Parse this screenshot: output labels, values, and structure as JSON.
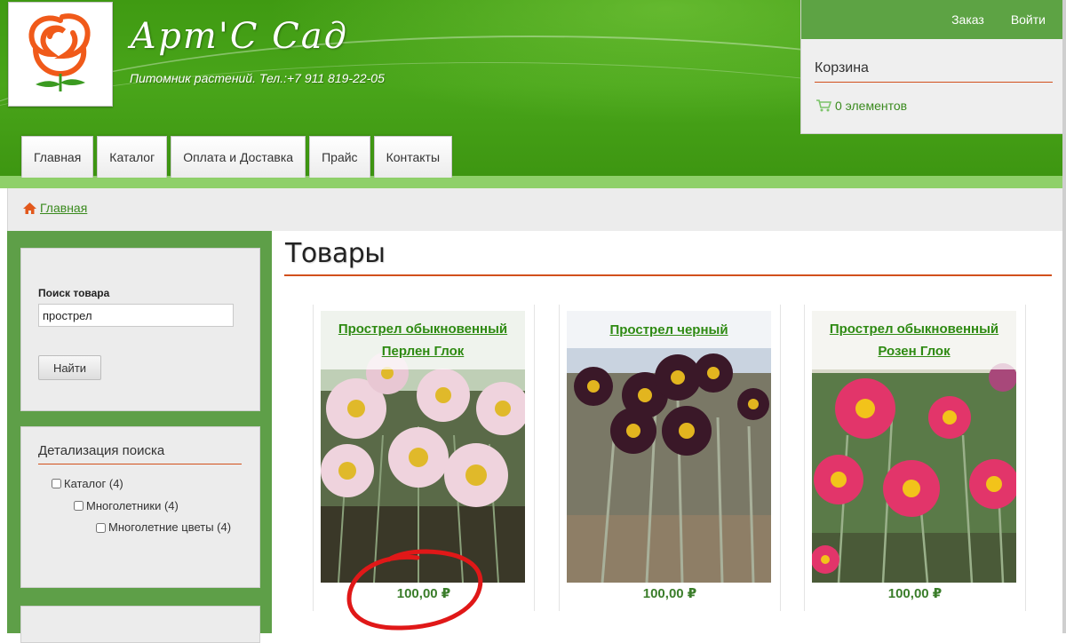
{
  "site": {
    "title": "Арт'С Сад",
    "subtitle": "Питомник растений. Тел.:+7 911 819-22-05"
  },
  "nav": {
    "items": [
      "Главная",
      "Каталог",
      "Оплата и Доставка",
      "Прайс",
      "Контакты"
    ]
  },
  "user_links": {
    "order": "Заказ",
    "login": "Войти"
  },
  "cart": {
    "title": "Корзина",
    "count_text": "0 элементов"
  },
  "breadcrumb": {
    "home": "Главная"
  },
  "search": {
    "label": "Поиск товара",
    "value": "прострел",
    "button": "Найти"
  },
  "refine": {
    "title": "Детализация поиска",
    "items": [
      {
        "label": "Каталог (4)",
        "checked": false
      },
      {
        "label": "Многолетники (4)",
        "checked": false
      },
      {
        "label": "Многолетние цветы (4)",
        "checked": false
      }
    ]
  },
  "main": {
    "title": "Товары"
  },
  "products": [
    {
      "name": "Прострел обыкновенный Перлен Глок",
      "price": "100,00 ₽",
      "flower_color": "#efd3dd",
      "center_color": "#e0b92a"
    },
    {
      "name": "Прострел черный",
      "price": "100,00 ₽",
      "flower_color": "#3a1828",
      "center_color": "#e2b51f"
    },
    {
      "name": "Прострел обыкновенный Розен Глок",
      "price": "100,00 ₽",
      "flower_color": "#e2356a",
      "center_color": "#f2c31a"
    }
  ],
  "colors": {
    "brand_green": "#3f9a12",
    "accent_orange": "#d2501c",
    "link_green": "#2e8a12",
    "annotation_red": "#e01818"
  }
}
